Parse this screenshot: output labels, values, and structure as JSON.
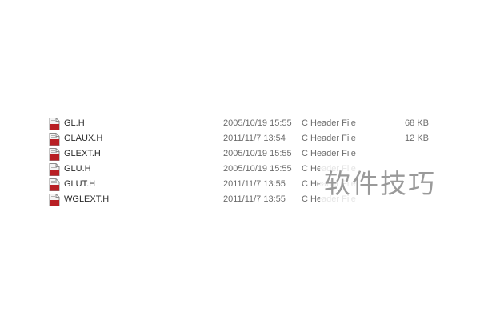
{
  "files": [
    {
      "name": "GL.H",
      "date": "2005/10/19 15:55",
      "type": "C Header File",
      "size": "68 KB",
      "icon": "c-header-file-icon"
    },
    {
      "name": "GLAUX.H",
      "date": "2011/11/7 13:54",
      "type": "C Header File",
      "size": "12 KB",
      "icon": "c-header-file-icon"
    },
    {
      "name": "GLEXT.H",
      "date": "2005/10/19 15:55",
      "type": "C Header File",
      "size": "",
      "icon": "c-header-file-icon"
    },
    {
      "name": "GLU.H",
      "date": "2005/10/19 15:55",
      "type": "C Header File",
      "size": "",
      "icon": "c-header-file-icon"
    },
    {
      "name": "GLUT.H",
      "date": "2011/11/7 13:55",
      "type": "C Header File",
      "size": "",
      "icon": "c-header-file-icon"
    },
    {
      "name": "WGLEXT.H",
      "date": "2011/11/7 13:55",
      "type": "C Header File",
      "size": "",
      "icon": "c-header-file-icon"
    }
  ],
  "watermark": {
    "text": "软件技巧"
  },
  "colors": {
    "icon_red": "#b81f24",
    "icon_paper": "#f4f4f4",
    "text_muted": "#6d6d6d"
  }
}
